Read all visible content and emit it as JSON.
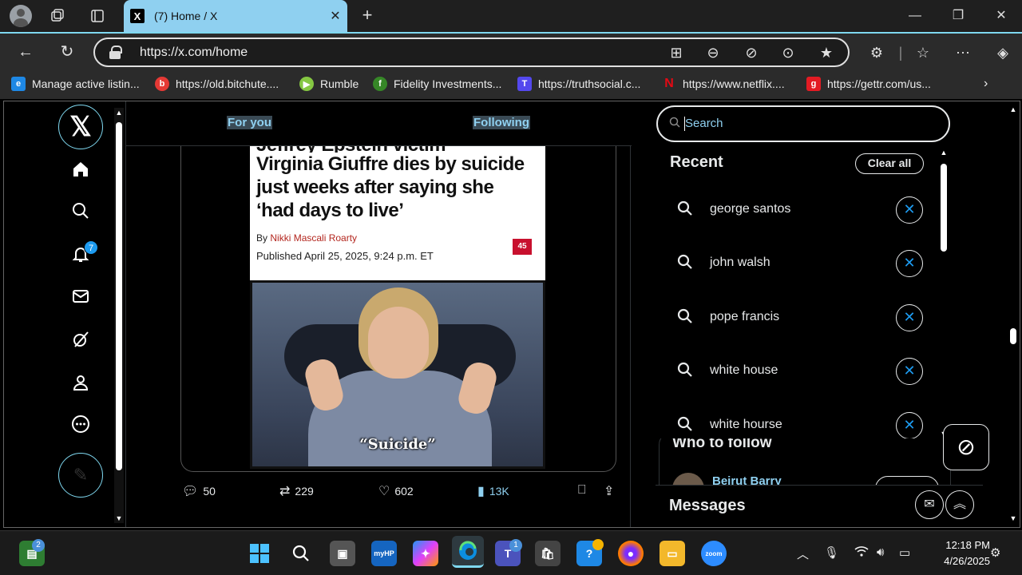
{
  "browser": {
    "tab": {
      "title": "(7) Home / X",
      "favicon": "X"
    },
    "address": {
      "url": "https://x.com/home"
    },
    "bookmarks": [
      {
        "label": "Manage active listin...",
        "color": "#1e88e5"
      },
      {
        "label": "https://old.bitchute....",
        "color": "#e53935"
      },
      {
        "label": "Rumble",
        "color": "#85c742"
      },
      {
        "label": "Fidelity Investments...",
        "color": "#368727"
      },
      {
        "label": "https://truthsocial.c...",
        "color": "#5448ee"
      },
      {
        "label": "https://www.netflix....",
        "color": "#e50914"
      },
      {
        "label": "https://gettr.com/us...",
        "color": "#e31b23"
      }
    ]
  },
  "x": {
    "notification_count": "7",
    "feed_tabs": {
      "for_you": "For you",
      "following": "Following"
    },
    "tweet": {
      "headline_partial": "Jeffrey Epstein victim",
      "headline": "Virginia Giuffre dies by suicide just weeks after saying she ‘had days to live’",
      "byline_prefix": "By",
      "author": "Nikki Mascali Roarty",
      "published": "Published April 25, 2025, 9:24 p.m. ET",
      "comment_count": "45",
      "image_caption": "“Suicide”",
      "stats": {
        "replies": "50",
        "reposts": "229",
        "likes": "602",
        "views": "13K"
      }
    },
    "search": {
      "placeholder": "Search",
      "recent_title": "Recent",
      "clear_all": "Clear all",
      "recent": [
        "george santos",
        "john walsh",
        "pope francis",
        "white house",
        "white hourse"
      ]
    },
    "who_to_follow": {
      "title": "Who to follow",
      "first_name": "Beirut Barry"
    },
    "messages": {
      "title": "Messages"
    }
  },
  "taskbar": {
    "widgets_badge": "2",
    "teams_badge": "1",
    "time": "12:18 PM",
    "date": "4/26/2025"
  },
  "colors": {
    "accent": "#1d9bf0",
    "link_highlight": "#8fd0f0"
  }
}
